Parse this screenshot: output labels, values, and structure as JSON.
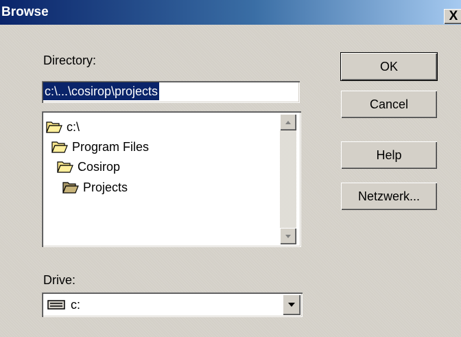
{
  "window": {
    "title": "Browse",
    "close_glyph": "X"
  },
  "directory": {
    "label": "Directory:",
    "value": "c:\\...\\cosirop\\projects"
  },
  "tree": {
    "items": [
      {
        "label": "c:\\",
        "icon": "open-folder-icon"
      },
      {
        "label": "Program Files",
        "icon": "open-folder-icon"
      },
      {
        "label": "Cosirop",
        "icon": "open-folder-icon"
      },
      {
        "label": "Projects",
        "icon": "open-folder-selected-icon"
      }
    ]
  },
  "drive": {
    "label": "Drive:",
    "value": "c:",
    "icon": "hard-drive-icon"
  },
  "buttons": {
    "ok": "OK",
    "cancel": "Cancel",
    "help": "Help",
    "network": "Netzwerk..."
  }
}
